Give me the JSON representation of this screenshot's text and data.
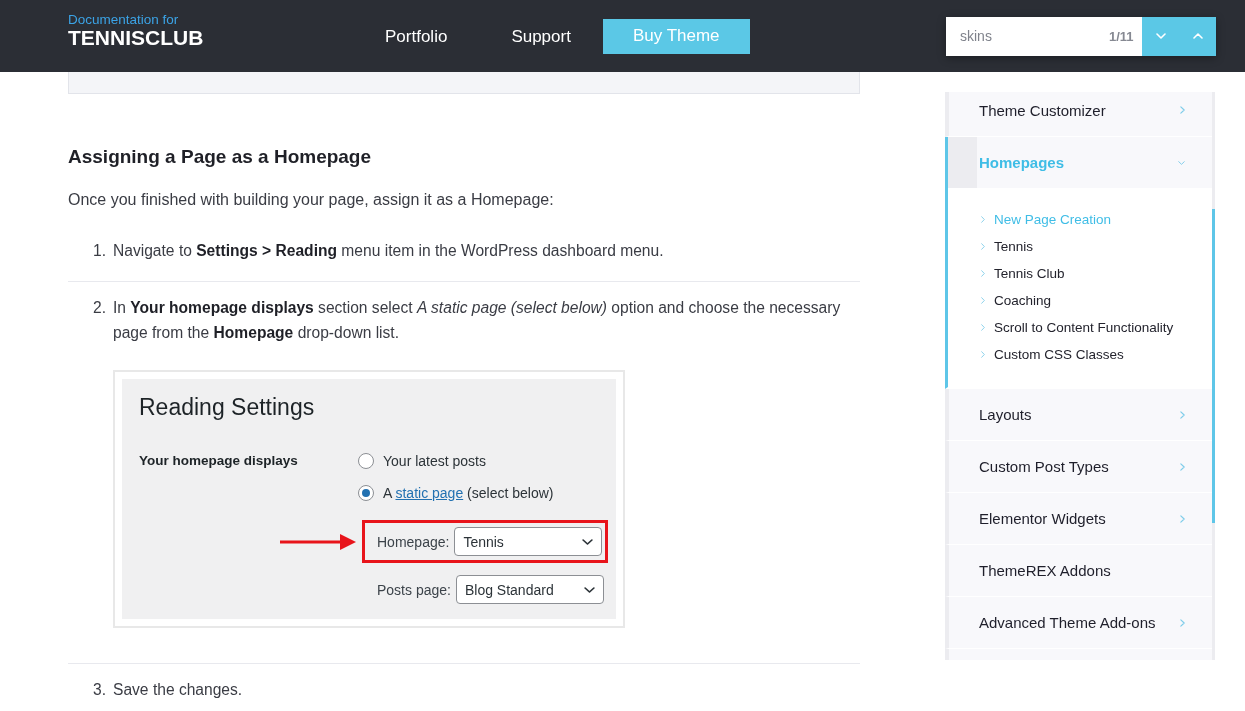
{
  "header": {
    "logo": {
      "subtitle": "Documentation for",
      "title": "TENNISCLUB"
    },
    "nav": [
      {
        "label": "Portfolio",
        "kind": "link"
      },
      {
        "label": "Support",
        "kind": "link"
      },
      {
        "label": "Buy Theme",
        "kind": "button"
      }
    ],
    "search": {
      "value": "skins",
      "count": "1/11"
    }
  },
  "article": {
    "heading": "Assigning a Page as a Homepage",
    "intro": "Once you finished with building your page, assign it as a Homepage:",
    "steps": [
      {
        "number": "1.",
        "text": "Navigate to **Settings > Reading** menu item in the WordPress dashboard menu."
      },
      {
        "number": "2.",
        "text": "In **Your homepage displays** section select *A static page (select below)* option and choose the necessary page from the **Homepage** drop-down list.",
        "screenshot": {
          "title": "Reading Settings",
          "field_label": "Your homepage displays",
          "options": [
            {
              "text": "Your latest posts",
              "selected": false
            },
            {
              "text": "A",
              "link": "static page",
              "after": "(select below)",
              "selected": true
            }
          ],
          "selects": [
            {
              "label": "Homepage:",
              "value": "Tennis",
              "highlighted": true
            },
            {
              "label": "Posts page:",
              "value": "Blog Standard",
              "highlighted": false
            }
          ]
        }
      },
      {
        "number": "3.",
        "text": "Save the changes."
      }
    ]
  },
  "sidebar": {
    "items": [
      {
        "label": "Theme Customizer",
        "kind": "submenu",
        "expanded": false
      },
      {
        "label": "Homepages",
        "kind": "submenu",
        "expanded": true,
        "children": [
          {
            "label": "New Page Creation",
            "selected": true
          },
          {
            "label": "Tennis",
            "selected": false
          },
          {
            "label": "Tennis Club",
            "selected": false
          },
          {
            "label": "Coaching",
            "selected": false
          },
          {
            "label": "Scroll to Content Functionality",
            "selected": false
          },
          {
            "label": "Custom CSS Classes",
            "selected": false
          }
        ]
      },
      {
        "label": "Layouts",
        "kind": "submenu",
        "expanded": false
      },
      {
        "label": "Custom Post Types",
        "kind": "submenu",
        "expanded": false
      },
      {
        "label": "Elementor Widgets",
        "kind": "submenu",
        "expanded": false
      },
      {
        "label": "ThemeREX Addons",
        "kind": "link",
        "expanded": false
      },
      {
        "label": "Advanced Theme Add-ons",
        "kind": "submenu",
        "expanded": false
      }
    ]
  }
}
